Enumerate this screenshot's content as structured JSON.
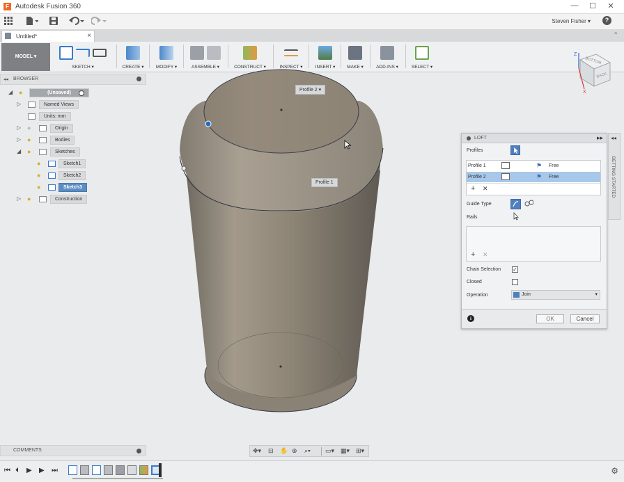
{
  "window": {
    "title": "Autodesk Fusion 360",
    "minimize": "—",
    "maximize": "☐",
    "close": "✕"
  },
  "appbar": {
    "user": "Steven Fisher ▾",
    "help": "?"
  },
  "tab": {
    "name": "Untitled*",
    "close": "×"
  },
  "ribbon": {
    "mode": "MODEL ▾",
    "groups": [
      "SKETCH ▾",
      "CREATE ▾",
      "MODIFY ▾",
      "ASSEMBLE ▾",
      "CONSTRUCT ▾",
      "INSPECT ▾",
      "INSERT ▾",
      "MAKE ▾",
      "ADD-INS ▾",
      "SELECT ▾"
    ]
  },
  "browser": {
    "title": "BROWSER",
    "collapse": "◂◂",
    "root": "(Unsaved)",
    "items": [
      "Named Views",
      "Units: mm",
      "Origin",
      "Bodies",
      "Sketches",
      "Sketch1",
      "Sketch2",
      "Sketch3",
      "Construction"
    ]
  },
  "viewport": {
    "profile2_tag": "Profile 2 ▾",
    "profile1_tag": "Profile 1"
  },
  "viewcube": {
    "top": "BOTTOM",
    "side": "BACK",
    "z": "Z",
    "x": "X"
  },
  "loft": {
    "title": "LOFT",
    "collapse": "▸▸",
    "profiles_label": "Profiles",
    "rows": [
      {
        "name": "Profile 1",
        "mode": "Free"
      },
      {
        "name": "Profile 2",
        "mode": "Free"
      }
    ],
    "add": "+",
    "remove": "✕",
    "guide_type_label": "Guide Type",
    "rails_label": "Rails",
    "chain_selection_label": "Chain Selection",
    "chain_selection_checked": "✓",
    "closed_label": "Closed",
    "operation_label": "Operation",
    "operation_value": "Join",
    "ok": "OK",
    "cancel": "Cancel",
    "info": "i"
  },
  "side_tab": "GETTING STARTED",
  "comments": {
    "title": "COMMENTS"
  },
  "colors": {
    "accent": "#5b8cc4",
    "selected_row": "#a7c8ea",
    "body": "#8d8475"
  }
}
